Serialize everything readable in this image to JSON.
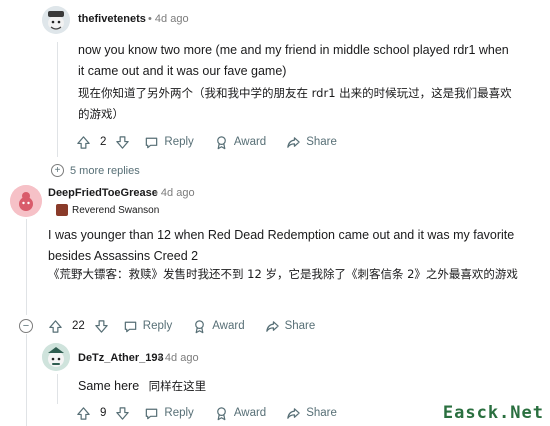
{
  "comments": [
    {
      "username": "thefivetenets",
      "age": "4d ago",
      "text_en": "now you know two more (me and my friend in middle school played rdr1 when it came out and it was our fave game)",
      "text_zh": "现在你知道了另外两个（我和我中学的朋友在 rdr1 出来的时候玩过，这是我们最喜欢的游戏）",
      "votes": "2",
      "reply_label": "Reply",
      "award_label": "Award",
      "share_label": "Share",
      "more_replies": "5 more replies"
    },
    {
      "username": "DeepFriedToeGrease",
      "age": "4d ago",
      "flair": "Reverend Swanson",
      "text_en": "I was younger than 12 when Red Dead Redemption came out and it was my favorite besides Assassins Creed 2",
      "text_zh": "《荒野大镖客：救赎》发售时我还不到 12 岁，它是我除了《刺客信条 2》之外最喜欢的游戏",
      "votes": "22",
      "reply_label": "Reply",
      "award_label": "Award",
      "share_label": "Share",
      "collapse_symbol": "−"
    },
    {
      "username": "DeTz_Ather_193",
      "age": "4d ago",
      "text_en": "Same here",
      "text_zh": "同样在这里",
      "votes": "9",
      "reply_label": "Reply",
      "award_label": "Award",
      "share_label": "Share"
    }
  ],
  "bullet": "•",
  "expand_symbol": "+",
  "watermark": "Easck.Net",
  "colors": {
    "meta_gray": "#7c7c7c",
    "action_gray": "#576f76",
    "flair_brown": "#8a3b2a",
    "watermark_green": "#2a6f3f"
  }
}
